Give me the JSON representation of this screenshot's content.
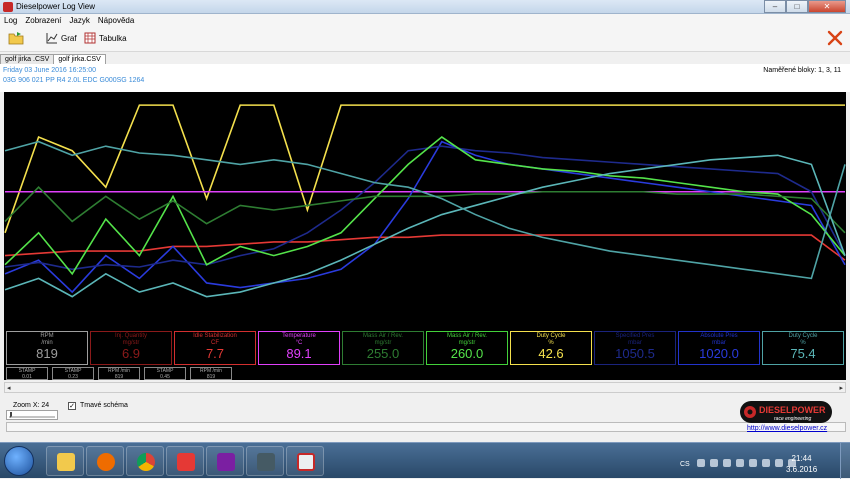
{
  "window": {
    "title": "Dieselpower Log View",
    "min": "–",
    "max": "□",
    "close": "✕"
  },
  "menu": [
    "Log",
    "Zobrazení",
    "Jazyk",
    "Nápověda"
  ],
  "toolbar": {
    "graph_label": "Graf",
    "table_label": "Tabulka"
  },
  "tabs": [
    "golf jirka .CSV",
    "golf jirka.CSV"
  ],
  "info": {
    "date": "Friday 03 June 2016 16:25:00",
    "ecu": "03G 906 021 PP  R4 2.0L EDC G000SG  1264",
    "blocks": "Naměřené bloky: 1, 3, 11"
  },
  "gauges": [
    {
      "name": "RPM",
      "unit": "/min",
      "value": "819",
      "color": "#9e9e9e",
      "value_color": "#9e9e9e"
    },
    {
      "name": "Inj. Quantity",
      "unit": "mg/str",
      "value": "6.9",
      "color": "#8b1a1a",
      "value_color": "#8b1a1a"
    },
    {
      "name": "Idle Stabilization",
      "unit": "CF",
      "value": "7.7",
      "color": "#d32f2f",
      "value_color": "#e53935"
    },
    {
      "name": "Temperature",
      "unit": "°C",
      "value": "89.1",
      "color": "#e040fb",
      "value_color": "#e040fb"
    },
    {
      "name": "Mass Air / Rev.",
      "unit": "mg/str",
      "value": "255.0",
      "color": "#2e7d32",
      "value_color": "#2e7d32"
    },
    {
      "name": "Mass Air / Rev.",
      "unit": "mg/str",
      "value": "260.0",
      "color": "#43d13a",
      "value_color": "#54e34a"
    },
    {
      "name": "Duty Cycle",
      "unit": "%",
      "value": "42.6",
      "color": "#f4e04d",
      "value_color": "#f4e04d"
    },
    {
      "name": "Specified Pres",
      "unit": "mbar",
      "value": "1050.5",
      "color": "#1a237e",
      "value_color": "#1e2a8c"
    },
    {
      "name": "Absolute Pres",
      "unit": "mbar",
      "value": "1020.0",
      "color": "#2233cc",
      "value_color": "#2a3bdd"
    },
    {
      "name": "Duty Cycle",
      "unit": "%",
      "value": "75.4",
      "color": "#4fa3a5",
      "value_color": "#5bb6b8"
    }
  ],
  "stamps": [
    {
      "label": "STAMP",
      "value": "0.01"
    },
    {
      "label": "STAMP",
      "value": "0.23"
    },
    {
      "label": "RPM /min",
      "value": "819"
    },
    {
      "label": "STAMP",
      "value": "0.45"
    },
    {
      "label": "RPM /min",
      "value": "819"
    }
  ],
  "bottom": {
    "zoom_label": "Zoom X: 24",
    "checkbox_label": "Tmavé schéma",
    "checkbox_checked": true,
    "logo_text": "DIESELPOWER",
    "logo_sub": "race engineering",
    "link": "http://www.dieselpower.cz"
  },
  "taskbar": {
    "lang": "CS",
    "time": "21:44",
    "date": "3.6.2016"
  },
  "chart_data": {
    "type": "line",
    "x": [
      0,
      4,
      8,
      12,
      16,
      20,
      24,
      28,
      32,
      36,
      40,
      44,
      48,
      52,
      56,
      60,
      64,
      68,
      72,
      76,
      80,
      84,
      88,
      92,
      96,
      100
    ],
    "ylim": [
      0,
      100
    ],
    "series": [
      {
        "color": "#f4e04d",
        "values": [
          40,
          82,
          76,
          60,
          96,
          96,
          55,
          96,
          96,
          50,
          96,
          96,
          96,
          96,
          96,
          96,
          96,
          96,
          96,
          96,
          96,
          96,
          96,
          96,
          96,
          96
        ]
      },
      {
        "color": "#e040fb",
        "values": [
          58,
          58,
          58,
          58,
          58,
          58,
          58,
          58,
          58,
          58,
          58,
          58,
          58,
          58,
          58,
          58,
          58,
          58,
          58,
          58,
          58,
          58,
          58,
          58,
          58,
          58
        ]
      },
      {
        "color": "#e53935",
        "values": [
          30,
          31,
          32,
          32,
          32,
          34,
          34,
          35,
          36,
          36,
          37,
          38,
          38,
          39,
          39,
          39,
          39,
          39,
          39,
          39,
          39,
          39,
          39,
          39,
          39,
          28
        ]
      },
      {
        "color": "#2a3bdd",
        "values": [
          22,
          28,
          14,
          30,
          20,
          34,
          18,
          16,
          18,
          20,
          24,
          35,
          55,
          80,
          74,
          70,
          68,
          66,
          64,
          62,
          60,
          58,
          56,
          54,
          52,
          26
        ]
      },
      {
        "color": "#1e2a8c",
        "values": [
          25,
          27,
          24,
          26,
          25,
          28,
          26,
          30,
          33,
          40,
          50,
          62,
          76,
          78,
          76,
          75,
          73,
          72,
          71,
          70,
          69,
          68,
          67,
          66,
          58,
          30
        ]
      },
      {
        "color": "#54e34a",
        "values": [
          26,
          40,
          22,
          46,
          30,
          56,
          26,
          34,
          30,
          34,
          40,
          55,
          70,
          82,
          72,
          70,
          68,
          67,
          65,
          64,
          62,
          60,
          58,
          57,
          48,
          30
        ]
      },
      {
        "color": "#2e7d32",
        "values": [
          45,
          60,
          45,
          56,
          46,
          54,
          44,
          52,
          50,
          52,
          54,
          56,
          56,
          56,
          57,
          57,
          58,
          58,
          58,
          58,
          57,
          57,
          57,
          56,
          55,
          40
        ]
      },
      {
        "color": "#5bb6b8",
        "values": [
          15,
          20,
          12,
          22,
          14,
          18,
          12,
          14,
          18,
          22,
          28,
          35,
          42,
          48,
          52,
          56,
          60,
          63,
          66,
          68,
          70,
          72,
          73,
          74,
          70,
          30
        ]
      },
      {
        "color": "#4fa3a5",
        "values": [
          76,
          80,
          74,
          78,
          75,
          74,
          72,
          70,
          72,
          70,
          66,
          62,
          60,
          55,
          48,
          42,
          38,
          35,
          32,
          30,
          28,
          26,
          24,
          22,
          20,
          70
        ]
      }
    ]
  }
}
